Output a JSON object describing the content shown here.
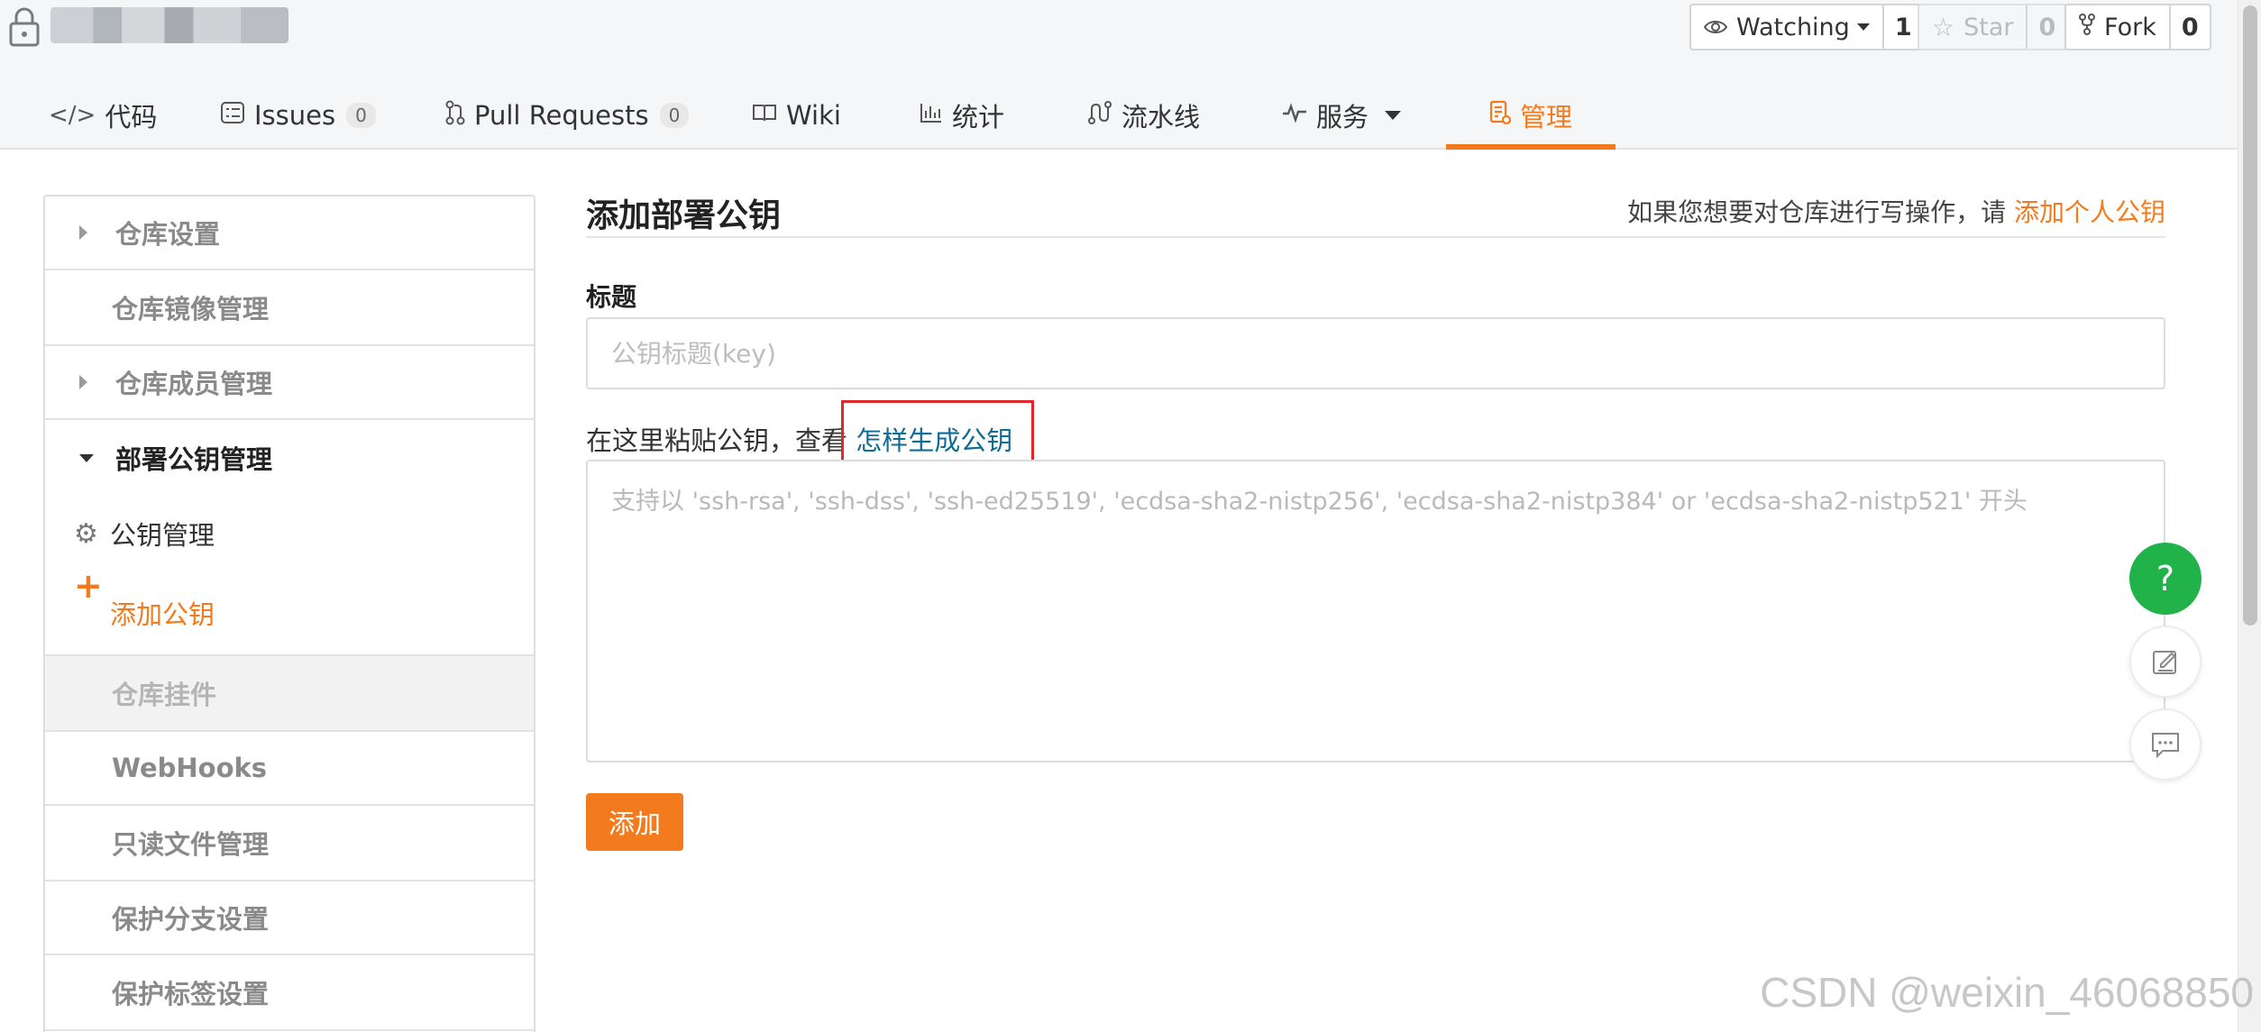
{
  "repo": {
    "name": ""
  },
  "header_buttons": {
    "watching": {
      "label": "Watching",
      "count": "1"
    },
    "star": {
      "label": "Star",
      "count": "0"
    },
    "fork": {
      "label": "Fork",
      "count": "0"
    }
  },
  "tabs": [
    {
      "label": "代码",
      "icon": "code-icon"
    },
    {
      "label": "Issues",
      "badge": "0",
      "icon": "issues-icon"
    },
    {
      "label": "Pull Requests",
      "badge": "0",
      "icon": "pull-request-icon"
    },
    {
      "label": "Wiki",
      "icon": "book-icon"
    },
    {
      "label": "统计",
      "icon": "bar-chart-icon"
    },
    {
      "label": "流水线",
      "icon": "pipeline-icon"
    },
    {
      "label": "服务",
      "icon": "pulse-icon"
    },
    {
      "label": "管理",
      "icon": "manage-icon",
      "active": true
    }
  ],
  "sidebar": {
    "items": [
      {
        "label": "仓库设置"
      },
      {
        "label": "仓库镜像管理"
      },
      {
        "label": "仓库成员管理"
      },
      {
        "label": "部署公钥管理"
      },
      {
        "label": "公钥管理"
      },
      {
        "label": "添加公钥"
      },
      {
        "label": "仓库挂件"
      },
      {
        "label": "WebHooks"
      },
      {
        "label": "只读文件管理"
      },
      {
        "label": "保护分支设置"
      },
      {
        "label": "保护标签设置"
      }
    ]
  },
  "form": {
    "title": "添加部署公钥",
    "hint_prefix": "如果您想要对仓库进行写操作，请 ",
    "hint_link": "添加个人公钥",
    "title_label": "标题",
    "title_placeholder": "公钥标题(key)",
    "paste_label": "在这里粘贴公钥，查看 ",
    "paste_link": "怎样生成公钥",
    "key_placeholder": "支持以 'ssh-rsa', 'ssh-dss', 'ssh-ed25519', 'ecdsa-sha2-nistp256', 'ecdsa-sha2-nistp384' or 'ecdsa-sha2-nistp521' 开头",
    "submit_label": "添加"
  },
  "floating": {
    "help_label": "?"
  },
  "watermark": "CSDN @weixin_46068850",
  "colors": {
    "accent": "#f37b1d",
    "link": "#0f6c92",
    "help": "#21b24a",
    "highlight": "#e0282b"
  }
}
